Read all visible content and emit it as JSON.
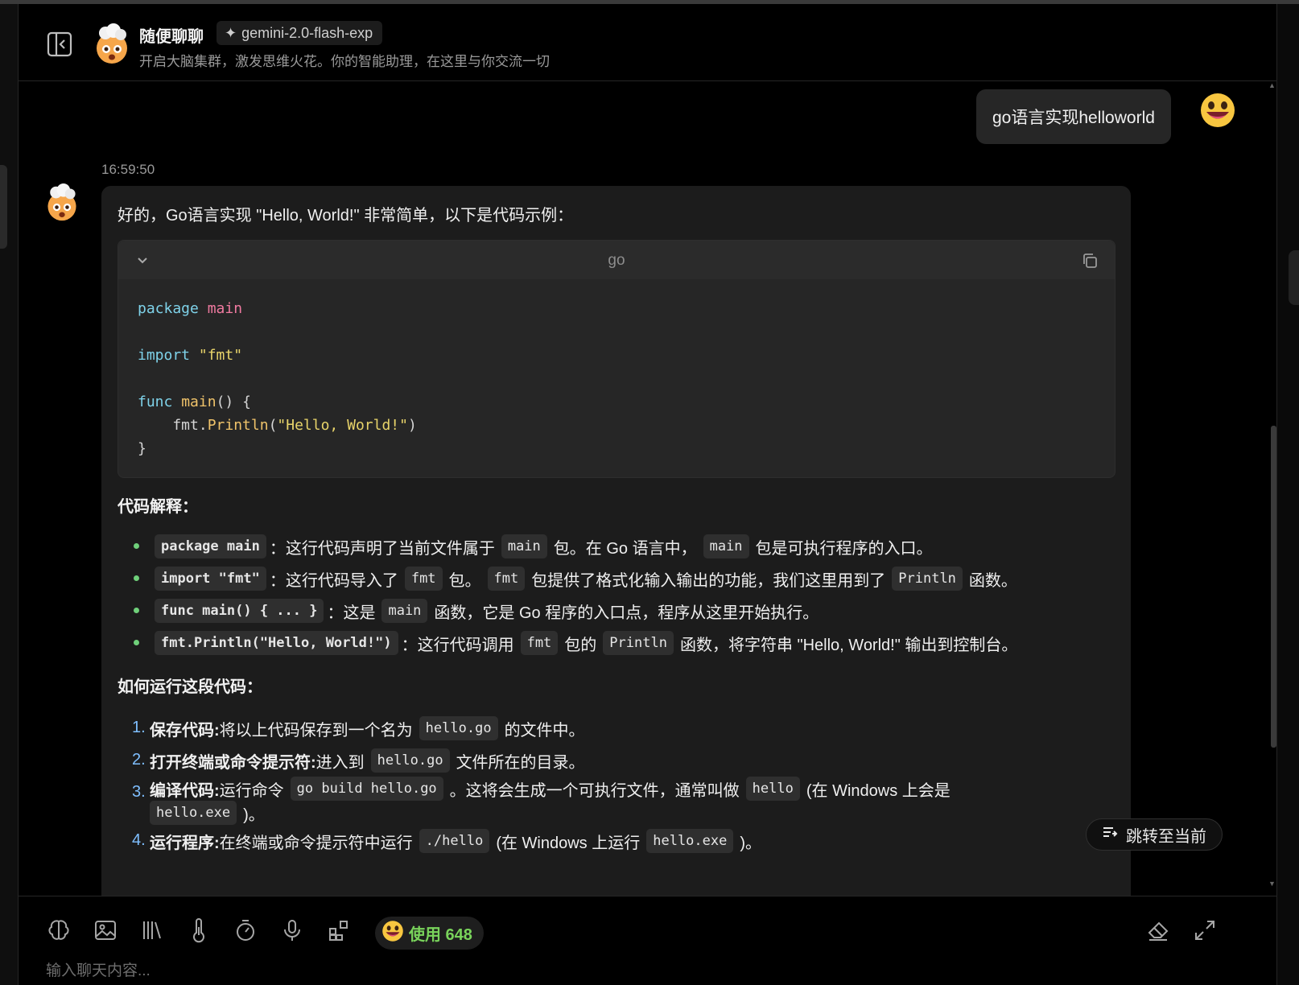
{
  "header": {
    "agent_name": "随便聊聊",
    "model_tag": "gemini-2.0-flash-exp",
    "model_icon": "sparkle-icon",
    "description": "开启大脑集群，激发思维火花。你的智能助理，在这里与你交流一切"
  },
  "conversation": {
    "user_message": "go语言实现helloworld",
    "timestamp": "16:59:50",
    "reply_intro": "好的，Go语言实现 \"Hello, World!\" 非常简单，以下是代码示例：",
    "code_block": {
      "language": "go",
      "lines": {
        "l1_kw": "package",
        "l1_id": "main",
        "l3_kw": "import",
        "l3_str": "\"fmt\"",
        "l5_kw": "func",
        "l5_fn": "main",
        "l5_rest": "() {",
        "l6_pre": "    fmt.",
        "l6_fn": "Println",
        "l6_paren_open": "(",
        "l6_str": "\"Hello, World!\"",
        "l6_paren_close": ")",
        "l7": "}"
      }
    },
    "explain_title": "代码解释：",
    "bullets": [
      {
        "code": "package main",
        "parts": [
          "：这行代码声明了当前文件属于",
          "main",
          "包。在 Go 语言中，",
          "main",
          "包是可执行程序的入口。"
        ]
      },
      {
        "code": "import \"fmt\"",
        "parts": [
          "：这行代码导入了",
          "fmt",
          "包。",
          "fmt",
          "包提供了格式化输入输出的功能，我们这里用到了",
          "Println",
          "函数。"
        ]
      },
      {
        "code": "func main() { ... }",
        "parts": [
          "：这是",
          "main",
          "函数，它是 Go 程序的入口点，程序从这里开始执行。"
        ]
      },
      {
        "code": "fmt.Println(\"Hello, World!\")",
        "parts": [
          "：这行代码调用",
          "fmt",
          "包的",
          "Println",
          "函数，将字符串 \"Hello, World!\" 输出到控制台。"
        ]
      }
    ],
    "run_title": "如何运行这段代码：",
    "steps": [
      {
        "num": "1.",
        "label": "保存代码:",
        "t1": " 将以上代码保存到一个名为",
        "c1": "hello.go",
        "t2": "的文件中。"
      },
      {
        "num": "2.",
        "label": "打开终端或命令提示符:",
        "t1": " 进入到",
        "c1": "hello.go",
        "t2": "文件所在的目录。"
      },
      {
        "num": "3.",
        "label": "编译代码:",
        "t1": " 运行命令",
        "c1": "go build hello.go",
        "t2": "。这将会生成一个可执行文件，通常叫做",
        "c2": "hello",
        "t3": "(在 Windows 上会是",
        "c3": "hello.exe",
        "t4": ")。"
      },
      {
        "num": "4.",
        "label": "运行程序:",
        "t1": " 在终端或命令提示符中运行",
        "c1": "./hello",
        "t2": "(在 Windows 上运行",
        "c2": "hello.exe",
        "t3": ")。"
      }
    ]
  },
  "jump_button": {
    "label": "跳转至当前",
    "icon": "list-jump-icon"
  },
  "input_bar": {
    "tools": [
      "brain-icon",
      "image-icon",
      "library-icon",
      "thermometer-icon",
      "timer-icon",
      "microphone-icon",
      "plugin-icon"
    ],
    "usage_label": "使用 648",
    "right_tools": [
      "eraser-icon",
      "expand-icon"
    ],
    "placeholder": "输入聊天内容..."
  },
  "colors": {
    "background": "#000000",
    "bubble": "#262626",
    "usage_green": "#79d35b",
    "bullet_green": "#6fd07a"
  }
}
